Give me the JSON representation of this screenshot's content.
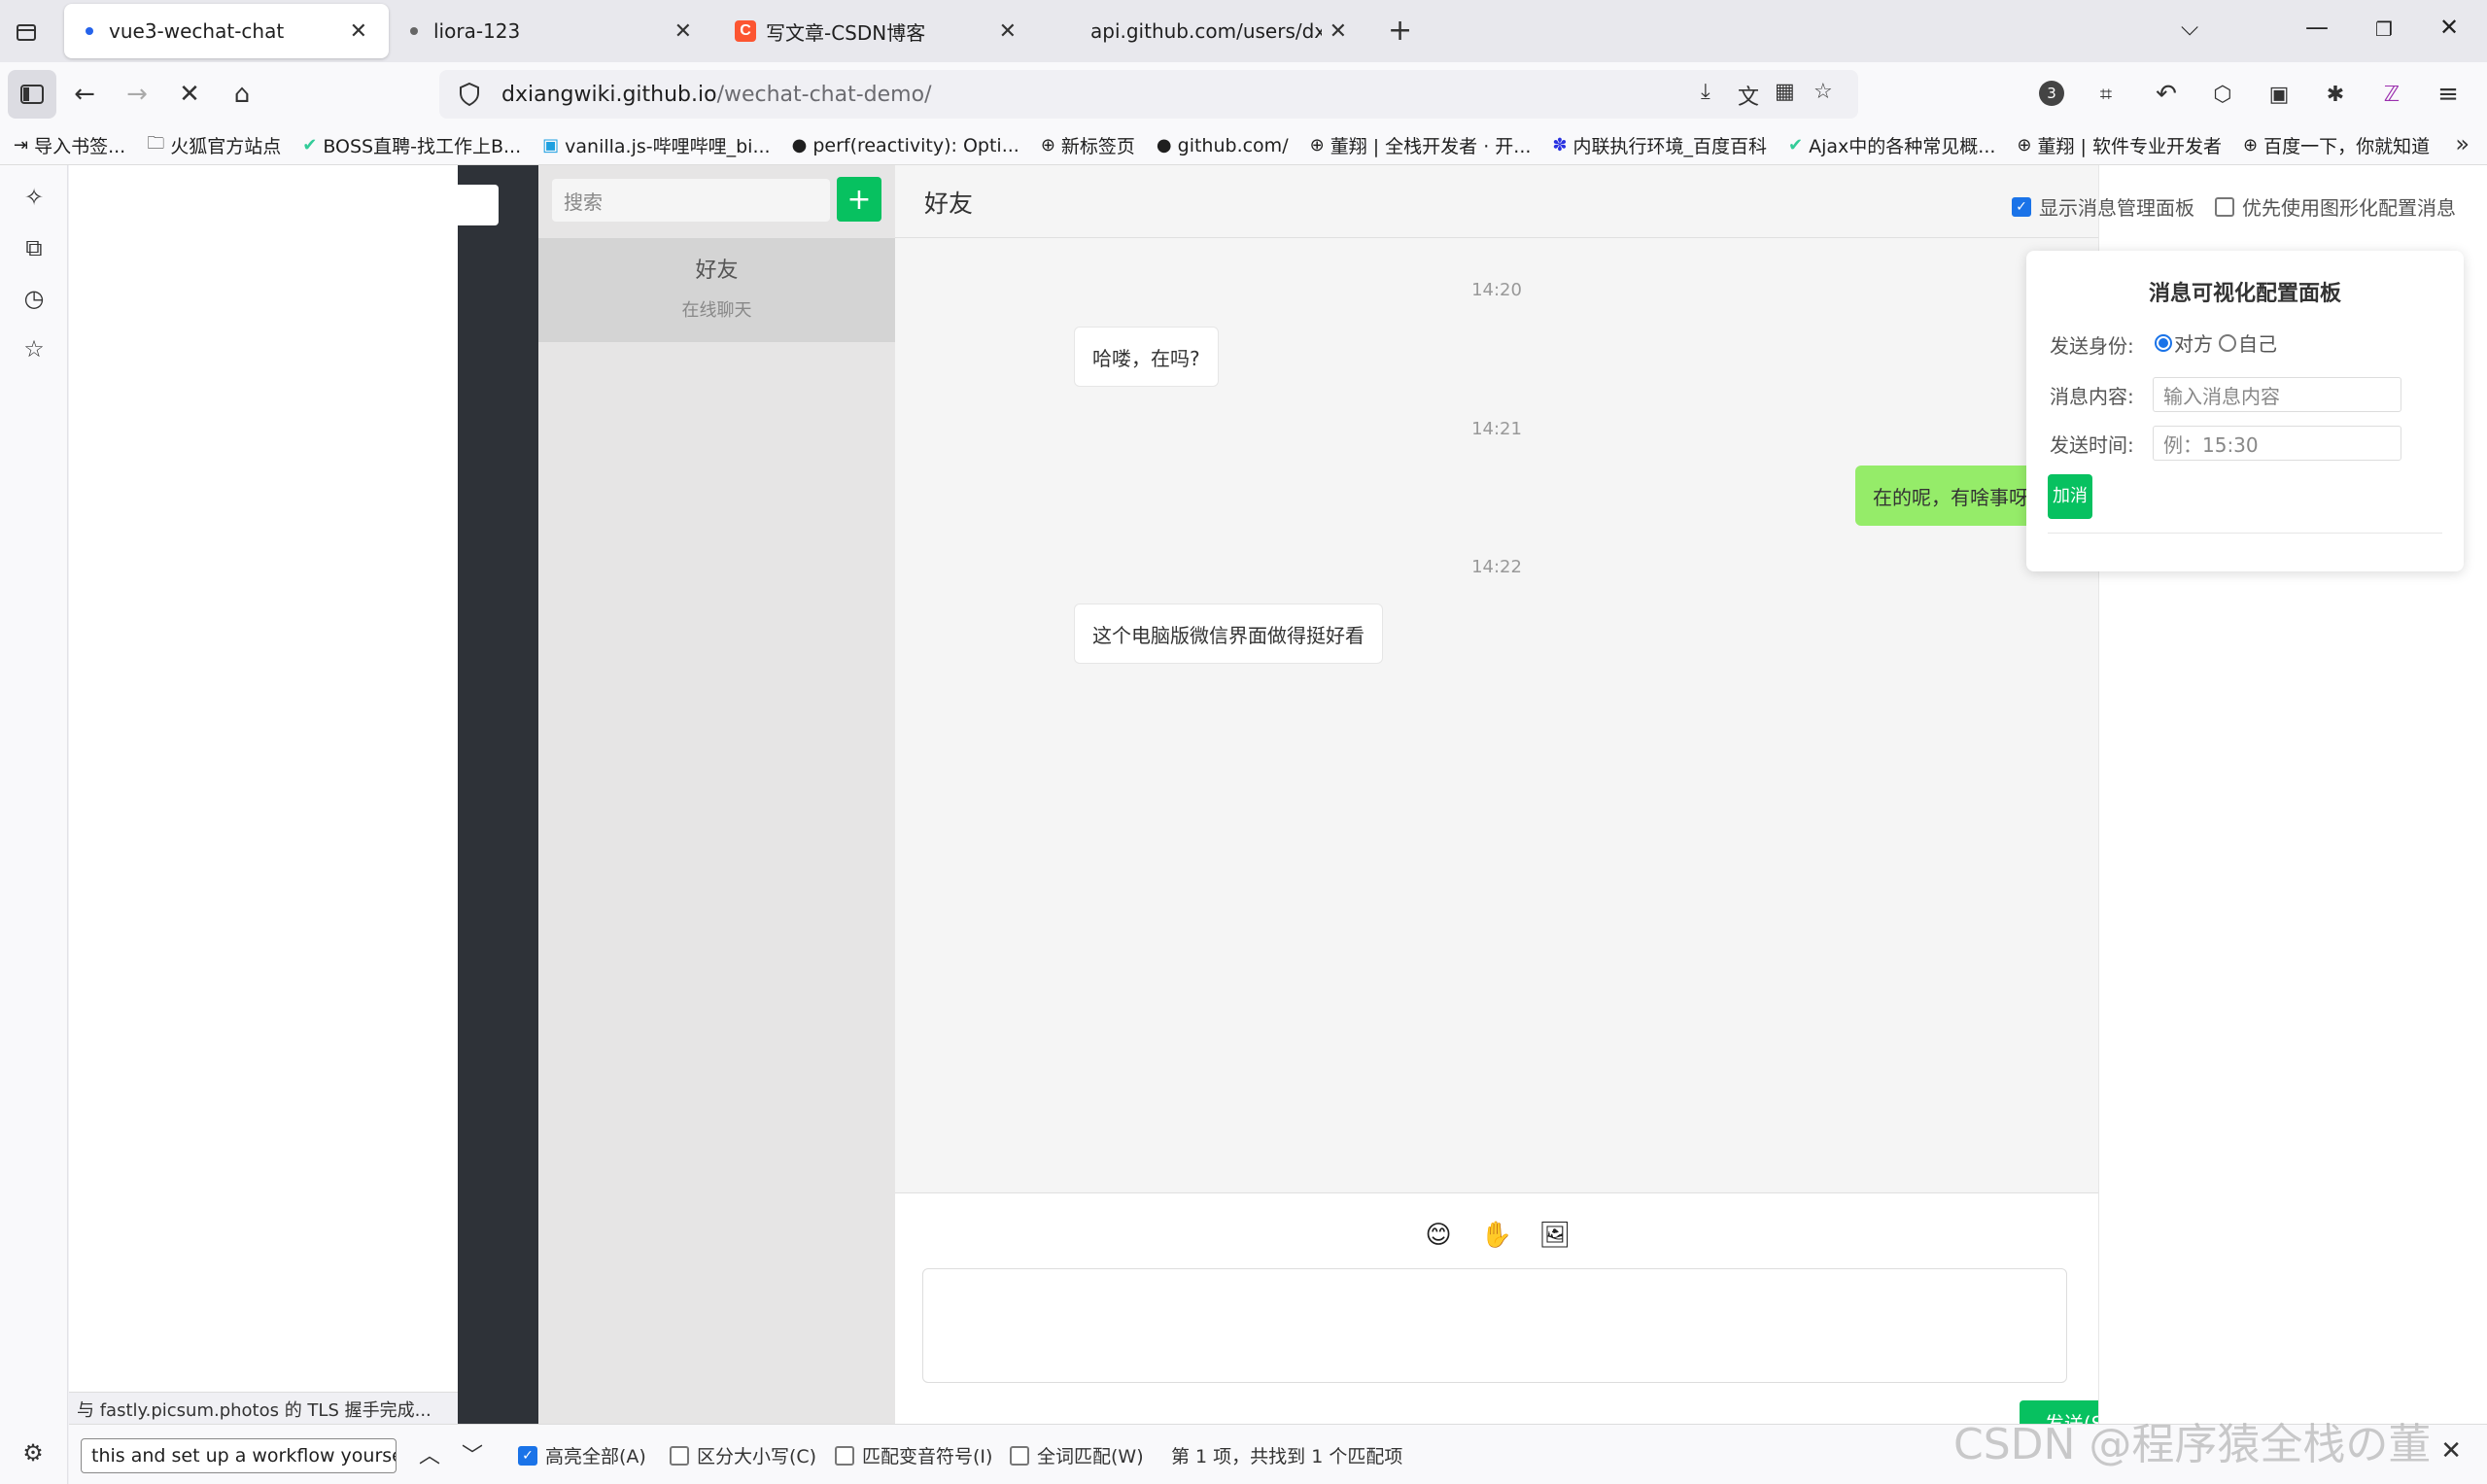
{
  "browser": {
    "tabs": [
      {
        "label": "vue3-wechat-chat",
        "active": true
      },
      {
        "label": "liora-123",
        "active": false
      },
      {
        "label": "写文章-CSDN博客",
        "active": false
      },
      {
        "label": "api.github.com/users/dxiang",
        "active": false
      }
    ],
    "url_host": "dxiangwiki.github.io",
    "url_path": "/wechat-chat-demo/",
    "extension_badge": "3",
    "bookmarks": [
      "导入书签...",
      "火狐官方站点",
      "BOSS直聘-找工作上B...",
      "vanilla.js-哔哩哔哩_bi...",
      "perf(reactivity): Opti...",
      "新标签页",
      "github.com/",
      "董翔 | 全栈开发者 · 开...",
      "内联执行环境_百度百科",
      "Ajax中的各种常见概...",
      "董翔 | 软件专业开发者",
      "百度一下，你就知道"
    ],
    "status_text": "与 fastly.picsum.photos 的 TLS 握手完成..."
  },
  "app": {
    "search_placeholder": "搜索",
    "add_label": "+",
    "contact": {
      "name": "好友",
      "status": "在线聊天"
    },
    "chat_title": "好友",
    "messages": [
      {
        "time": "14:20",
        "text": "哈喽，在吗?",
        "from": "other"
      },
      {
        "time": "14:21",
        "text": "在的呢，有啥事呀",
        "from": "self"
      },
      {
        "time": "14:22",
        "text": "这个电脑版微信界面做得挺好看",
        "from": "other"
      }
    ],
    "send_label": "发送(S)",
    "options": {
      "show_panel": "显示消息管理面板",
      "prefer_graphic": "优先使用图形化配置消息"
    },
    "panel": {
      "title": "消息可视化配置面板",
      "identity_label": "发送身份:",
      "identity_other": "对方",
      "identity_self": "自己",
      "content_label": "消息内容:",
      "content_placeholder": "输入消息内容",
      "time_label": "发送时间:",
      "time_placeholder": "例：15:30",
      "add_label": "加消"
    }
  },
  "findbar": {
    "query": "this and set up a workflow yourself",
    "highlight_all": "高亮全部(A)",
    "match_case": "区分大小写(C)",
    "match_diacritics": "匹配变音符号(I)",
    "whole_words": "全词匹配(W)",
    "result": "第 1 项，共找到 1 个匹配项"
  },
  "watermark": "CSDN @程序猿全栈の董",
  "colors": {
    "wechat_green": "#07c160",
    "self_bubble": "#95ec69",
    "sidebar_dark": "#2e3238"
  }
}
